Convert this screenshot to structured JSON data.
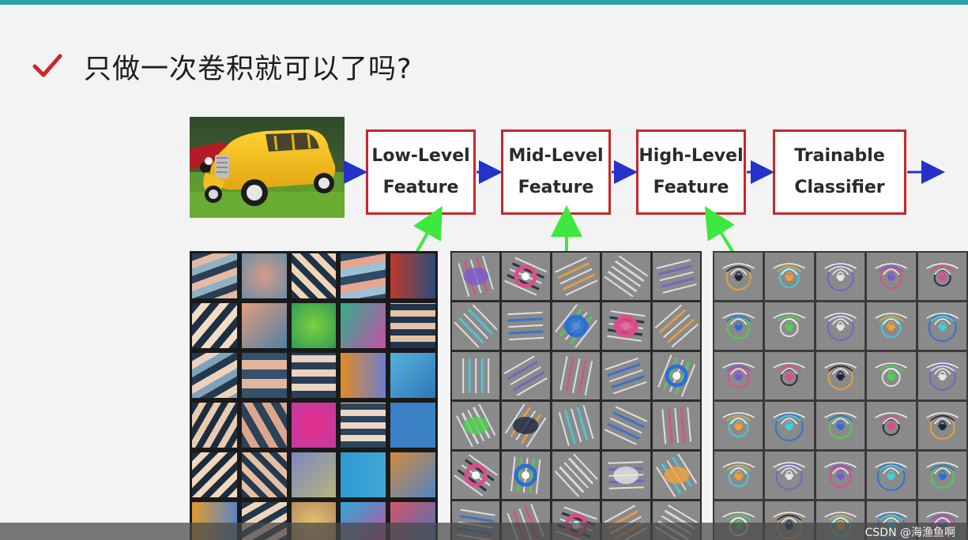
{
  "slide": {
    "title": "只做一次卷积就可以了吗?",
    "accent_color": "#2aa5b0",
    "check_color": "#c9262b"
  },
  "pipeline": {
    "input_image": "car-photo",
    "stages": [
      {
        "id": "low",
        "label": "Low-Level\nFeature"
      },
      {
        "id": "mid",
        "label": "Mid-Level\nFeature"
      },
      {
        "id": "high",
        "label": "High-Level\nFeature"
      },
      {
        "id": "classifier",
        "label": "Trainable\nClassifier"
      }
    ],
    "box_color": "#c9262b",
    "flow_arrow_color": "#2432c8",
    "link_arrow_color": "#3ee83e"
  },
  "feature_grids": [
    {
      "id": "low",
      "visual": "color-oriented-edge-filters"
    },
    {
      "id": "mid",
      "visual": "texture-pattern-filters"
    },
    {
      "id": "high",
      "visual": "object-part-filters"
    }
  ],
  "watermark": "CSDN @海渔鱼啊"
}
